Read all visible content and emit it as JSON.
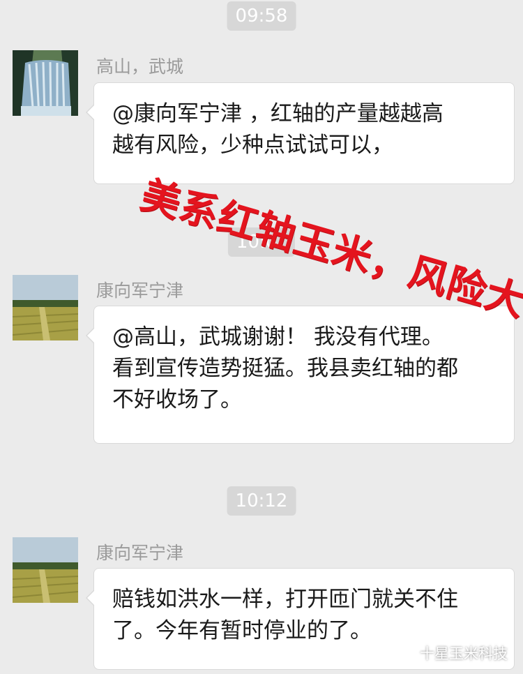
{
  "chat": {
    "timestamps": [
      "09:58",
      "10:12"
    ],
    "covered_timestamp": "10:0?",
    "messages": [
      {
        "sender": "高山，武城",
        "avatar": "waterfall-avatar",
        "lines": [
          "@康向军宁津 ，红轴的产量越越高",
          "越有风险，少种点试试可以，"
        ]
      },
      {
        "sender": "康向军宁津",
        "avatar": "wheat-field-avatar",
        "lines": [
          "@高山，武城谢谢！ 我没有代理。",
          "看到宣传造势挺猛。我县卖红轴的都",
          "不好收场了。"
        ]
      },
      {
        "sender": "康向军宁津",
        "avatar": "wheat-field-avatar",
        "lines": [
          "赔钱如洪水一样，打开匝门就关不住",
          "了。今年有暂时停业的了。"
        ]
      }
    ]
  },
  "overlay": {
    "text": "美系红轴玉米，风险大！",
    "color": "#e4141e"
  },
  "watermark": {
    "text": "十星玉米科技",
    "icon": "wechat-icon"
  },
  "colors": {
    "background": "#ebebeb",
    "bubble": "#ffffff",
    "timestamp_badge": "#d7d7d7",
    "sender_text": "#9a9a9a"
  }
}
